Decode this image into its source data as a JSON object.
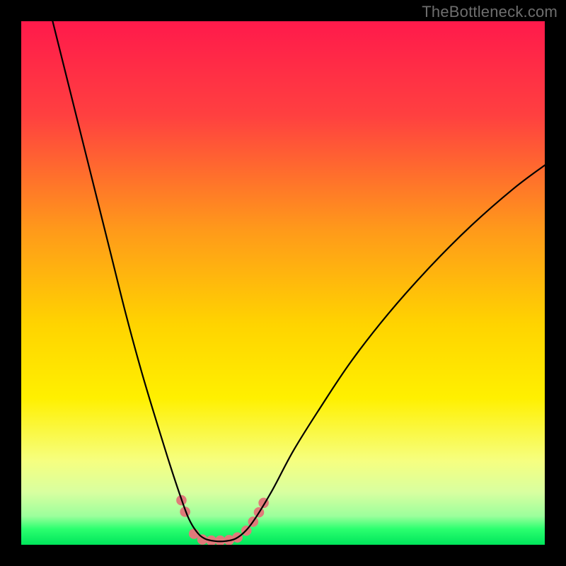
{
  "watermark": "TheBottleneck.com",
  "chart_data": {
    "type": "line",
    "title": "",
    "xlabel": "",
    "ylabel": "",
    "xlim": [
      0,
      100
    ],
    "ylim": [
      0,
      100
    ],
    "grid": false,
    "legend": false,
    "background_gradient_stops": [
      {
        "offset": 0.0,
        "color": "#ff1a4b"
      },
      {
        "offset": 0.18,
        "color": "#ff4040"
      },
      {
        "offset": 0.4,
        "color": "#ff9a1a"
      },
      {
        "offset": 0.58,
        "color": "#ffd400"
      },
      {
        "offset": 0.72,
        "color": "#fff000"
      },
      {
        "offset": 0.84,
        "color": "#f6ff80"
      },
      {
        "offset": 0.9,
        "color": "#d8ffa0"
      },
      {
        "offset": 0.945,
        "color": "#9cff9c"
      },
      {
        "offset": 0.97,
        "color": "#2bff6f"
      },
      {
        "offset": 1.0,
        "color": "#00e55b"
      }
    ],
    "series": [
      {
        "name": "curve",
        "stroke": "#000000",
        "stroke_width": 2.2,
        "points": [
          {
            "x": 6.0,
            "y": 100.0
          },
          {
            "x": 8.0,
            "y": 92.0
          },
          {
            "x": 11.0,
            "y": 80.0
          },
          {
            "x": 14.0,
            "y": 68.0
          },
          {
            "x": 17.0,
            "y": 56.0
          },
          {
            "x": 20.0,
            "y": 44.0
          },
          {
            "x": 23.0,
            "y": 33.0
          },
          {
            "x": 26.0,
            "y": 23.0
          },
          {
            "x": 28.5,
            "y": 15.0
          },
          {
            "x": 30.5,
            "y": 9.0
          },
          {
            "x": 32.0,
            "y": 5.0
          },
          {
            "x": 33.5,
            "y": 2.5
          },
          {
            "x": 35.0,
            "y": 1.2
          },
          {
            "x": 37.0,
            "y": 0.7
          },
          {
            "x": 39.0,
            "y": 0.7
          },
          {
            "x": 41.0,
            "y": 1.2
          },
          {
            "x": 43.0,
            "y": 2.8
          },
          {
            "x": 45.0,
            "y": 5.5
          },
          {
            "x": 48.0,
            "y": 10.5
          },
          {
            "x": 52.0,
            "y": 18.0
          },
          {
            "x": 57.0,
            "y": 26.0
          },
          {
            "x": 63.0,
            "y": 35.0
          },
          {
            "x": 70.0,
            "y": 44.0
          },
          {
            "x": 78.0,
            "y": 53.0
          },
          {
            "x": 86.0,
            "y": 61.0
          },
          {
            "x": 94.0,
            "y": 68.0
          },
          {
            "x": 100.0,
            "y": 72.5
          }
        ]
      }
    ],
    "markers": {
      "name": "highlight",
      "fill": "#e07a7a",
      "stroke": "#e07a7a",
      "radius": 6.8,
      "points": [
        {
          "x": 30.6,
          "y": 8.5
        },
        {
          "x": 31.3,
          "y": 6.3
        },
        {
          "x": 33.0,
          "y": 2.1
        },
        {
          "x": 34.6,
          "y": 1.0
        },
        {
          "x": 36.3,
          "y": 0.8
        },
        {
          "x": 38.0,
          "y": 0.8
        },
        {
          "x": 39.7,
          "y": 0.9
        },
        {
          "x": 41.3,
          "y": 1.4
        },
        {
          "x": 43.0,
          "y": 2.7
        },
        {
          "x": 44.3,
          "y": 4.4
        },
        {
          "x": 45.4,
          "y": 6.2
        },
        {
          "x": 46.3,
          "y": 8.0
        }
      ]
    }
  }
}
